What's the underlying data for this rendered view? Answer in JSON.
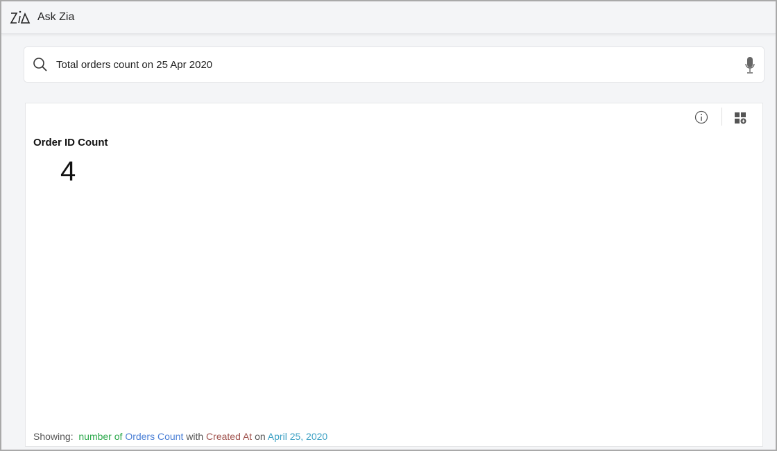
{
  "header": {
    "title": "Ask Zia",
    "logo": "zia-logo"
  },
  "search": {
    "query": "Total orders count on 25 Apr 2020"
  },
  "card": {
    "metric_label": "Order ID Count",
    "metric_value": "4",
    "footer": {
      "prefix": "Showing:",
      "part1": "number of",
      "part2": "Orders Count",
      "part3": "with",
      "part4": "Created At",
      "part5": "on",
      "part6": "April 25, 2020"
    }
  },
  "colors": {
    "green": "#2aa84a",
    "blue": "#4a7fd6",
    "brown": "#a0524d",
    "teal": "#3ba0c4"
  }
}
